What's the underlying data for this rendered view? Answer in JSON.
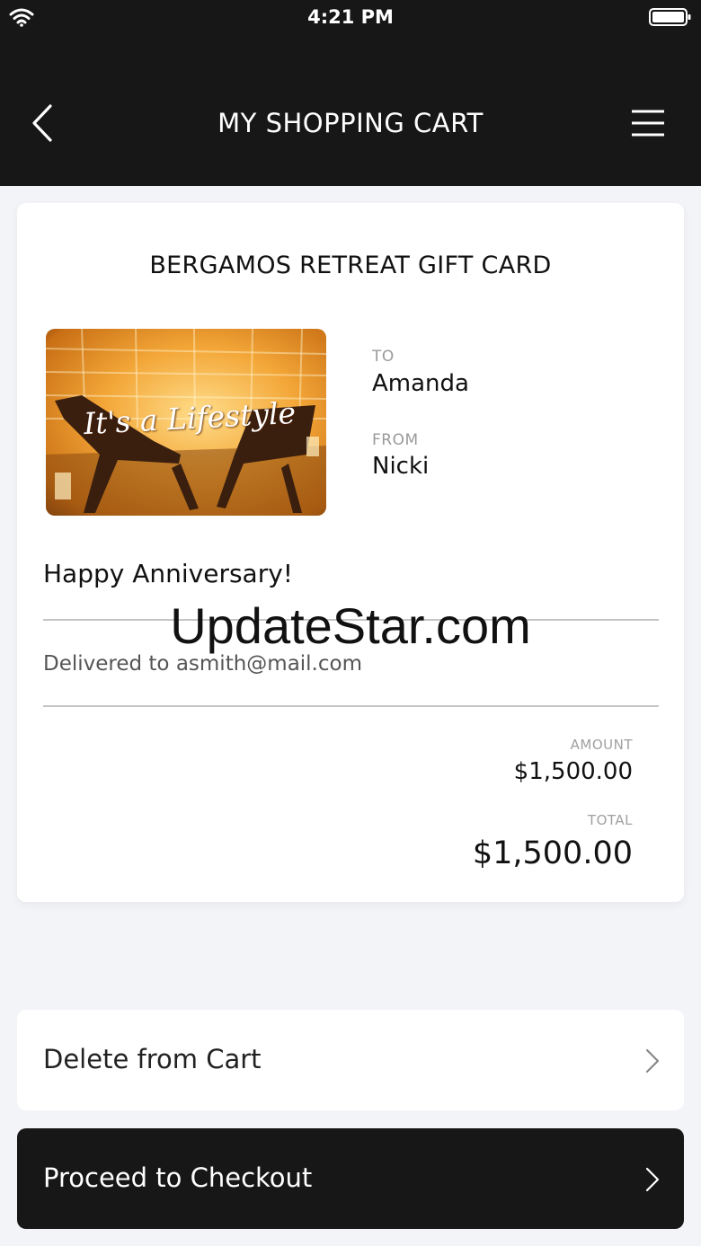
{
  "status_bar": {
    "time": "4:21 PM",
    "wifi_icon": "wifi-icon",
    "battery_icon": "battery-icon"
  },
  "header": {
    "title": "MY SHOPPING CART",
    "back_icon": "chevron-left-icon",
    "menu_icon": "hamburger-menu-icon"
  },
  "cart_item": {
    "title": "BERGAMOS RETREAT GIFT CARD",
    "image_caption": "It's a Lifestyle",
    "to_label": "TO",
    "to_value": "Amanda",
    "from_label": "FROM",
    "from_value": "Nicki",
    "message": "Happy Anniversary!",
    "delivered_to": "Delivered to asmith@mail.com",
    "amount_label": "AMOUNT",
    "amount_value": "$1,500.00",
    "total_label": "TOTAL",
    "total_value": "$1,500.00"
  },
  "watermark": "UpdateStar.com",
  "actions": {
    "delete_label": "Delete from Cart",
    "checkout_label": "Proceed to Checkout"
  },
  "colors": {
    "header_bg": "#171717",
    "page_bg": "#f3f4f8",
    "card_bg": "#ffffff",
    "checkout_bg": "#171717"
  }
}
